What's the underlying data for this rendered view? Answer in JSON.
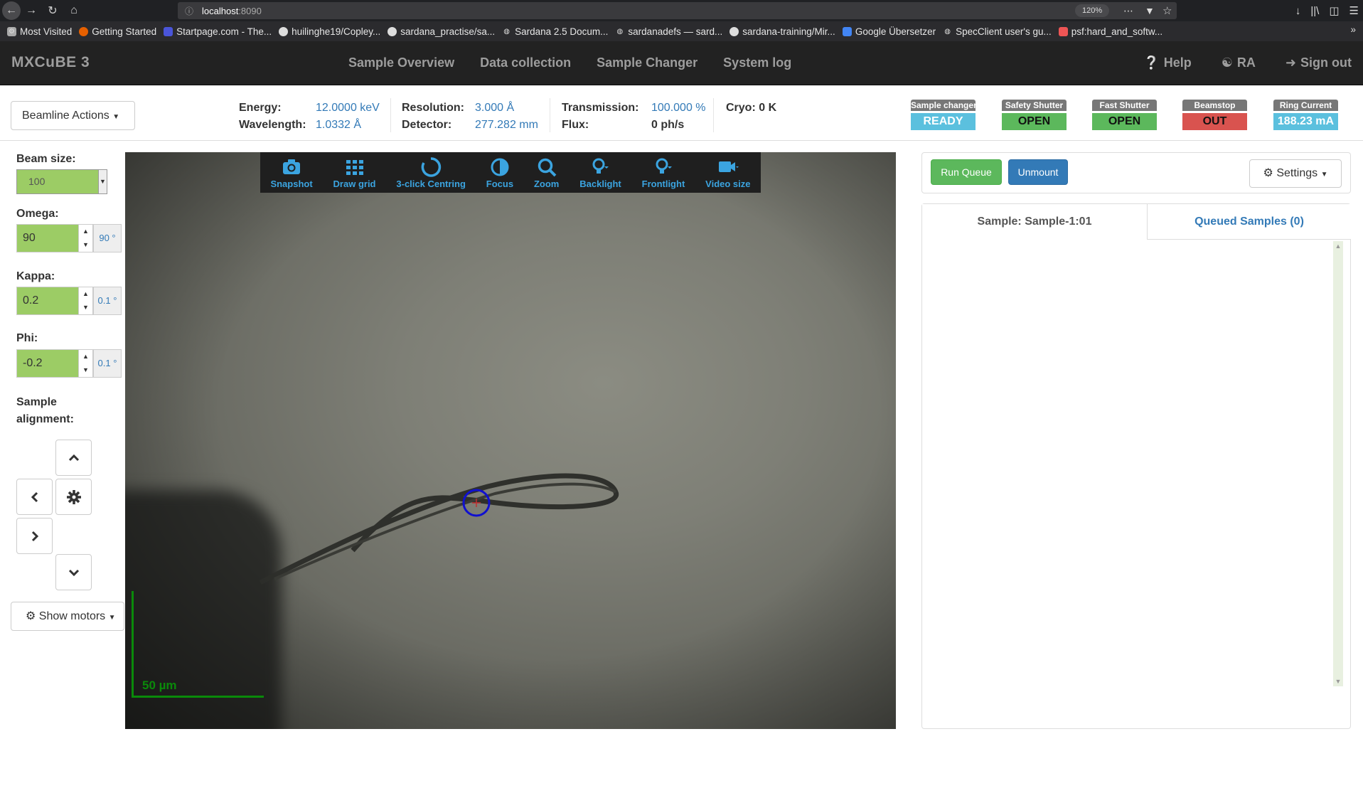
{
  "browser": {
    "url_host": "localhost",
    "url_port": ":8090",
    "zoom": "120%",
    "bookmarks": [
      {
        "label": "Most Visited",
        "icon": "gear-icon"
      },
      {
        "label": "Getting Started",
        "icon": "firefox-icon"
      },
      {
        "label": "Startpage.com - The...",
        "icon": "flag-icon"
      },
      {
        "label": "huilinghe19/Copley...",
        "icon": "github-icon"
      },
      {
        "label": "sardana_practise/sa...",
        "icon": "github-icon"
      },
      {
        "label": "Sardana 2.5 Docum...",
        "icon": "globe-icon"
      },
      {
        "label": "sardanadefs — sard...",
        "icon": "globe-icon"
      },
      {
        "label": "sardana-training/Mir...",
        "icon": "github-icon"
      },
      {
        "label": "Google Übersetzer",
        "icon": "translate-icon"
      },
      {
        "label": "SpecClient user's gu...",
        "icon": "globe-icon"
      },
      {
        "label": "psf:hard_and_softw...",
        "icon": "doc-icon"
      }
    ]
  },
  "navbar": {
    "brand": "MXCuBE 3",
    "links": [
      "Sample Overview",
      "Data collection",
      "Sample Changer",
      "System log"
    ],
    "help": "Help",
    "user": "RA",
    "signout": "Sign out"
  },
  "beamline": {
    "actions_label": "Beamline Actions",
    "energy_label": "Energy:",
    "energy_value": "12.0000 keV",
    "wavelength_label": "Wavelength:",
    "wavelength_value": "1.0332 Å",
    "resolution_label": "Resolution:",
    "resolution_value": "3.000 Å",
    "detector_label": "Detector:",
    "detector_value": "277.282 mm",
    "transmission_label": "Transmission:",
    "transmission_value": "100.000 %",
    "flux_label": "Flux:",
    "flux_value": "0 ph/s",
    "cryo_label": "Cryo:",
    "cryo_value": "0 K",
    "status": [
      {
        "title": "Sample changer",
        "value": "READY",
        "color": "#5bc0de"
      },
      {
        "title": "Safety Shutter",
        "value": "OPEN",
        "color": "#5cb85c"
      },
      {
        "title": "Fast Shutter",
        "value": "OPEN",
        "color": "#5cb85c"
      },
      {
        "title": "Beamstop",
        "value": "OUT",
        "color": "#d9534f"
      },
      {
        "title": "Ring Current",
        "value": "188.23 mA",
        "color": "#5bc0de"
      }
    ]
  },
  "motors": {
    "beam_size_label": "Beam size:",
    "beam_size_value": "100",
    "omega_label": "Omega:",
    "omega_value": "90",
    "omega_step": "90 °",
    "kappa_label": "Kappa:",
    "kappa_value": "0.2",
    "kappa_step": "0.1 °",
    "phi_label": "Phi:",
    "phi_value": "-0.2",
    "phi_step": "0.1 °",
    "alignment_label": "Sample alignment:",
    "show_motors": "Show motors"
  },
  "video": {
    "tools": [
      "Snapshot",
      "Draw grid",
      "3-click Centring",
      "Focus",
      "Zoom",
      "Backlight",
      "Frontlight",
      "Video size"
    ],
    "scale_label": "50 µm"
  },
  "queue": {
    "run_queue": "Run Queue",
    "unmount": "Unmount",
    "settings": "Settings",
    "tab_sample": "Sample: Sample-1:01",
    "tab_queued": "Queued Samples (0)"
  }
}
